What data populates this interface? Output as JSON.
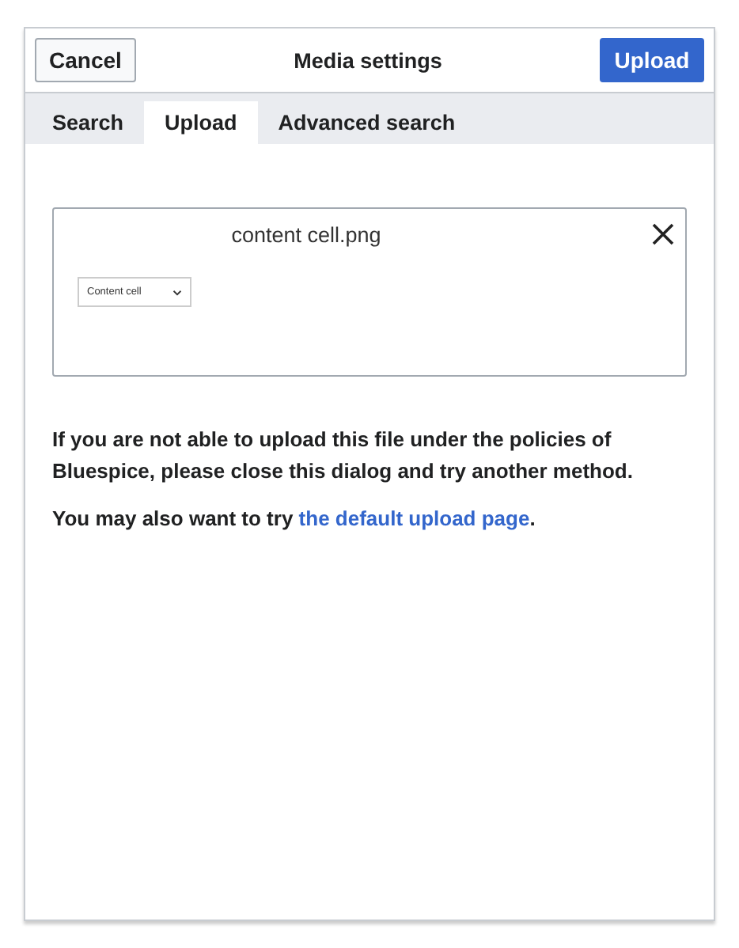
{
  "dialog": {
    "title": "Media settings",
    "cancel": "Cancel",
    "primary": "Upload"
  },
  "tabs": [
    {
      "label": "Search",
      "selected": false
    },
    {
      "label": "Upload",
      "selected": true
    },
    {
      "label": "Advanced search",
      "selected": false
    }
  ],
  "file": {
    "name": "content cell.png",
    "preview_dropdown": "Content cell"
  },
  "notice": {
    "text": "If you are not able to upload this file under the policies of Bluespice, please close this dialog and try another method.",
    "prefix": "You may also want to try ",
    "link": "the default upload page",
    "suffix": "."
  }
}
